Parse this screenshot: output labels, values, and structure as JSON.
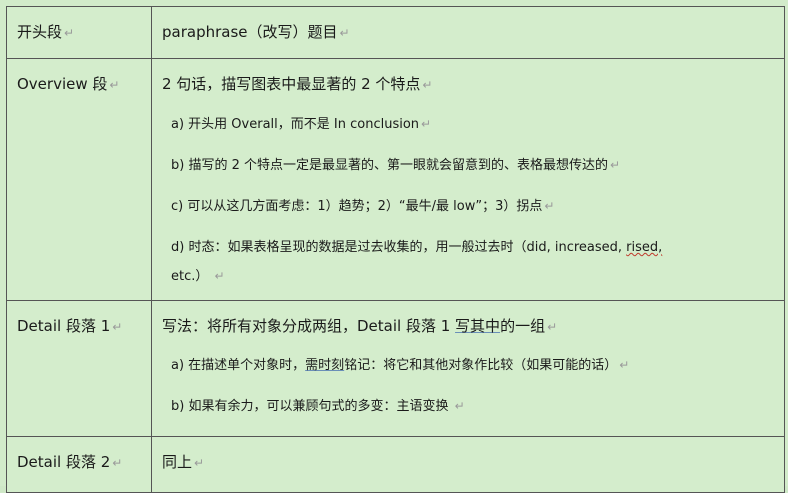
{
  "rows": [
    {
      "label": "开头段",
      "main": "paraphrase（改写）题目",
      "items": []
    },
    {
      "label": "Overview 段",
      "main": "2 句话，描写图表中最显著的 2 个特点",
      "items": [
        "a) 开头用 Overall，而不是 In conclusion",
        "b) 描写的 2 个特点一定是最显著的、第一眼就会留意到的、表格最想传达的",
        "c) 可以从这几方面考虑：1）趋势；2）“最牛/最 low”；3）拐点",
        "d) 时态：如果表格呈现的数据是过去收集的，用一般过去时（did, increased, ",
        "rised,",
        "etc.）"
      ]
    },
    {
      "label": "Detail 段落 1",
      "main_pre": "写法：将所有对象分成两组，Detail 段落 1 ",
      "main_ul": "写其中",
      "main_post": "的一组",
      "items_pre": "a) 在描述单个对象时，",
      "items_ul": "需时刻",
      "items_post": "铭记：将它和其他对象作比较（如果可能的话）",
      "item_b": "b) 如果有余力，可以兼顾句式的多变：主语变换"
    },
    {
      "label": "Detail 段落 2",
      "main": "同上"
    }
  ],
  "mark": "↵"
}
